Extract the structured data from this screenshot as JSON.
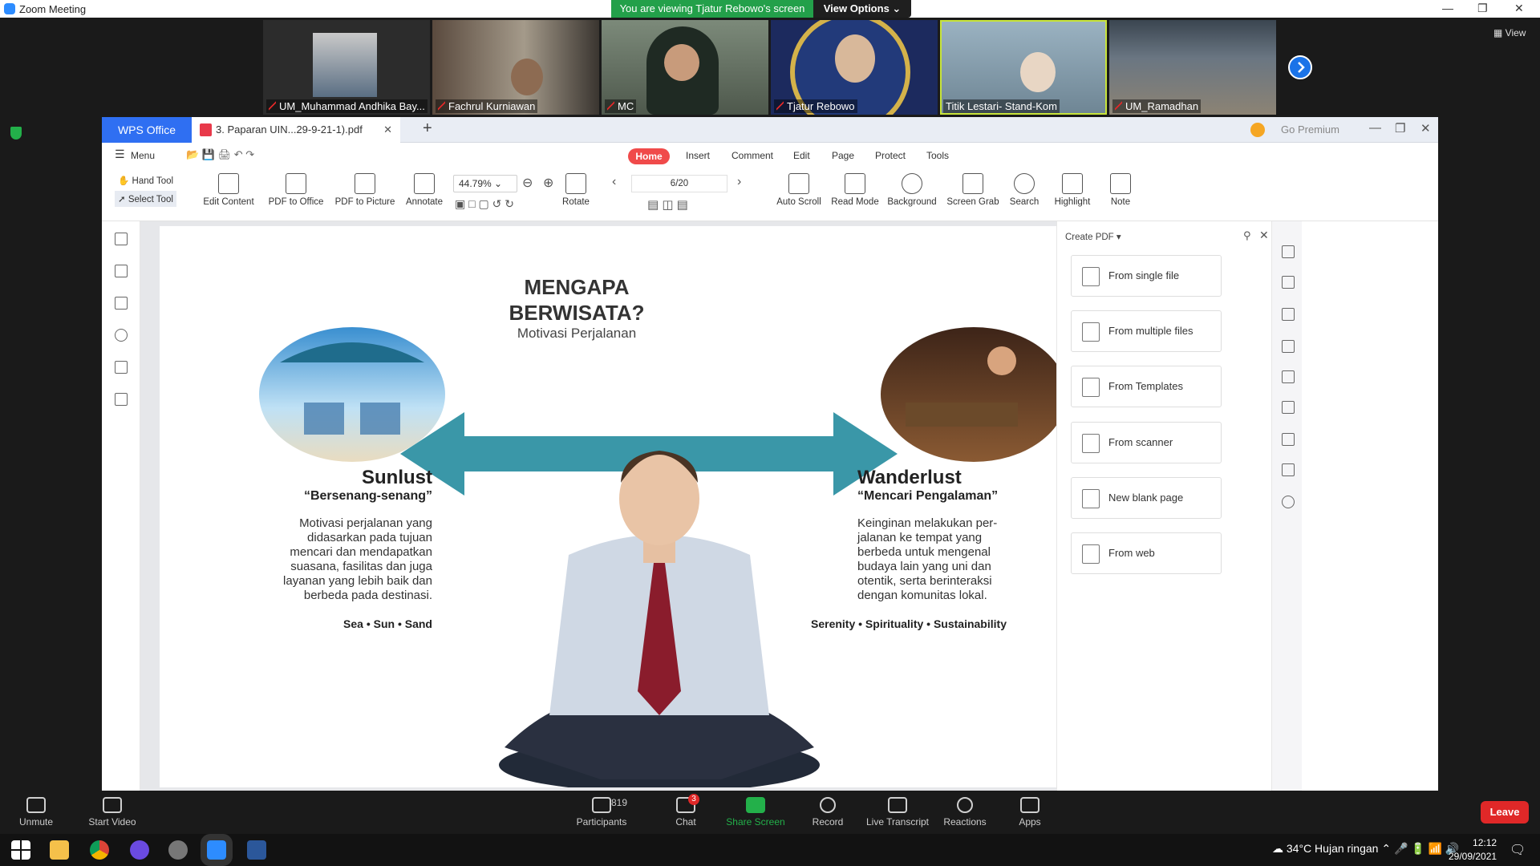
{
  "zoom": {
    "window_title": "Zoom Meeting",
    "sharing_banner": "You are viewing Tjatur Rebowo's screen",
    "view_options_label": "View Options",
    "view_label": "View",
    "participants": [
      {
        "name": "UM_Muhammad Andhika Bay..."
      },
      {
        "name": "Fachrul Kurniawan"
      },
      {
        "name": "MC"
      },
      {
        "name": "Tjatur Rebowo"
      },
      {
        "name": "Titik Lestari- Stand-Kom"
      },
      {
        "name": "UM_Ramadhan"
      }
    ],
    "bottom": {
      "unmute": "Unmute",
      "start_video": "Start Video",
      "participants_label": "Participants",
      "participants_count": "819",
      "chat": "Chat",
      "chat_badge": "3",
      "share_screen": "Share Screen",
      "record": "Record",
      "live_transcript": "Live Transcript",
      "reactions": "Reactions",
      "apps": "Apps",
      "leave": "Leave"
    }
  },
  "wps": {
    "app_tab": "WPS Office",
    "doc_tab": "3. Paparan UIN...29-9-21-1).pdf",
    "premium": "Go Premium",
    "menu_label": "Menu",
    "tabs": [
      "Home",
      "Insert",
      "Comment",
      "Edit",
      "Page",
      "Protect",
      "Tools"
    ],
    "toolbar": {
      "hand_tool": "Hand Tool",
      "select_tool": "Select Tool",
      "edit_content": "Edit Content",
      "pdf_to_office": "PDF to Office",
      "pdf_to_picture": "PDF to Picture",
      "annotate": "Annotate",
      "zoom": "44.79%",
      "rotate": "Rotate",
      "page_indicator": "6/20",
      "auto_scroll": "Auto Scroll",
      "read_mode": "Read Mode",
      "background": "Background",
      "screen_grab": "Screen Grab",
      "search": "Search",
      "highlight": "Highlight",
      "note": "Note"
    },
    "panel": {
      "header": "Create PDF",
      "items": [
        "From single file",
        "From multiple files",
        "From Templates",
        "From scanner",
        "New blank page",
        "From web"
      ]
    }
  },
  "slide": {
    "title_line1": "MENGAPA",
    "title_line2": "BERWISATA?",
    "subtitle": "Motivasi Perjalanan",
    "left": {
      "heading": "Sunlust",
      "quote": "“Bersenang-senang”",
      "body": [
        "Motivasi perjalanan yang",
        "didasarkan pada tujuan",
        "mencari dan mendapatkan",
        "suasana, fasilitas dan juga",
        "layanan yang lebih baik dan",
        "berbeda pada destinasi."
      ],
      "tagline": "Sea • Sun • Sand"
    },
    "right": {
      "heading": "Wanderlust",
      "quote": "“Mencari Pengalaman”",
      "body": [
        "Keinginan melakukan per-",
        "jalanan ke tempat yang",
        "berbeda untuk mengenal",
        "budaya lain yang uni dan",
        "otentik, serta berinteraksi",
        "dengan komunitas lokal."
      ],
      "tagline": "Serenity • Spirituality • Sustainability"
    }
  },
  "taskbar": {
    "weather": "34°C  Hujan ringan",
    "time": "12:12",
    "date": "29/09/2021"
  },
  "colors": {
    "zoom_green": "#23a04a",
    "wps_blue": "#2f6ff2",
    "home_red": "#f04a4a",
    "arrow_teal": "#3a97a8",
    "leave_red": "#e02828"
  }
}
